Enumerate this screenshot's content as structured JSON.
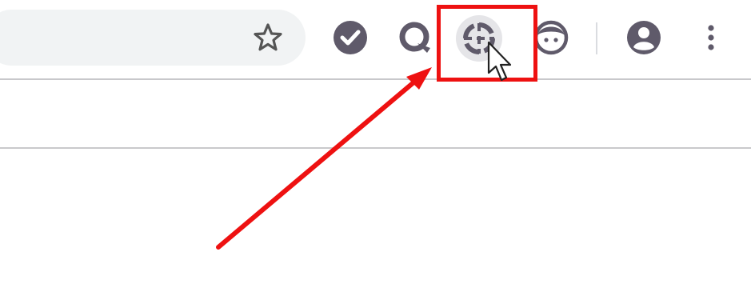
{
  "toolbar": {
    "bookmark_star_icon": "star-outline-icon",
    "extensions": [
      {
        "name": "checkmark-extension",
        "icon": "check-circle-icon"
      },
      {
        "name": "q-extension",
        "icon": "q-logo-icon"
      },
      {
        "name": "target-extension",
        "icon": "crosshair-target-icon"
      },
      {
        "name": "face-extension",
        "icon": "face-icon"
      }
    ],
    "profile_icon": "account-circle-icon",
    "menu_icon": "kebab-menu-icon"
  },
  "annotation": {
    "highlight_color": "#ee1111",
    "arrow_color": "#ee1111",
    "target": "target-extension"
  },
  "colors": {
    "icon": "#5f5a6a",
    "omnibox_bg": "#f1f3f4",
    "border": "#c8c8cb"
  }
}
